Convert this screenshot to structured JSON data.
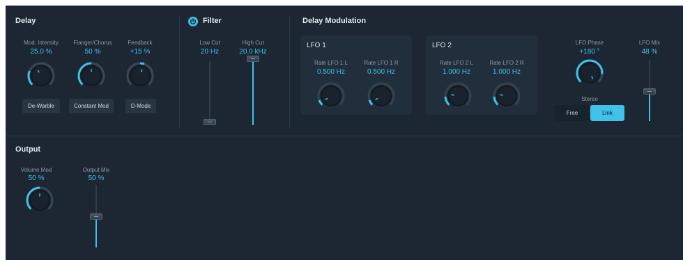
{
  "colors": {
    "background": "#1c2733",
    "accent": "#3fc1ea",
    "panel": "#212f3c",
    "button": "#2a3542"
  },
  "delay": {
    "title": "Delay",
    "mod_intensity": {
      "label": "Mod. Intensity",
      "value": "25.0 %"
    },
    "flanger_chorus": {
      "label": "Flanger/Chorus",
      "value": "50 %"
    },
    "feedback": {
      "label": "Feedback",
      "value": "+15 %"
    },
    "buttons": {
      "dewarble": "De-Warble",
      "constant_mod": "Constant Mod",
      "dmode": "D-Mode"
    }
  },
  "filter": {
    "title": "Filter",
    "power_icon": "power-icon",
    "low_cut": {
      "label": "Low Cut",
      "value": "20 Hz",
      "level": 0.0
    },
    "high_cut": {
      "label": "High Cut",
      "value": "20.0 kHz",
      "level": 1.0
    }
  },
  "modulation": {
    "title": "Delay Modulation",
    "lfo1": {
      "title": "LFO 1",
      "rate_l": {
        "label": "Rate LFO 1 L",
        "value": "0.500 Hz"
      },
      "rate_r": {
        "label": "Rate LFO 1 R",
        "value": "0.500 Hz"
      }
    },
    "lfo2": {
      "title": "LFO 2",
      "rate_l": {
        "label": "Rate LFO 2 L",
        "value": "1.000 Hz"
      },
      "rate_r": {
        "label": "Rate LFO 2 R",
        "value": "1.000 Hz"
      }
    },
    "lfo_phase": {
      "label": "LFO Phase",
      "value": "+180 °"
    },
    "stereo": {
      "label": "Stereo",
      "options": [
        "Free",
        "Link"
      ],
      "selected": "Link"
    },
    "lfo_mix": {
      "label": "LFO Mix",
      "value": "48 %",
      "level": 0.48
    }
  },
  "output": {
    "title": "Output",
    "volume_mod": {
      "label": "Volume Mod",
      "value": "50 %"
    },
    "output_mix": {
      "label": "Output Mix",
      "value": "50 %",
      "level": 0.5
    }
  }
}
